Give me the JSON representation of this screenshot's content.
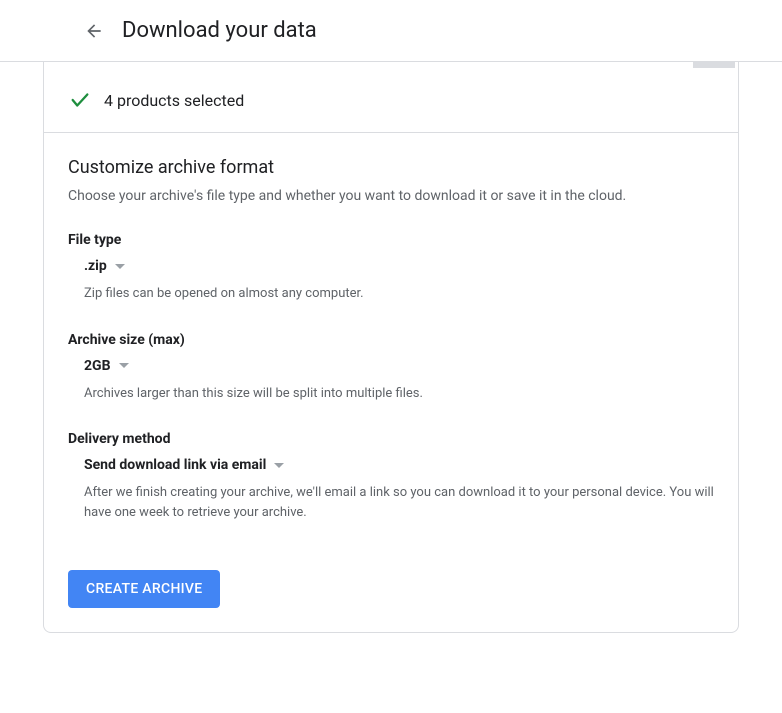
{
  "header": {
    "title": "Download your data"
  },
  "selected": {
    "text": "4 products selected"
  },
  "section": {
    "title": "Customize archive format",
    "description": "Choose your archive's file type and whether you want to download it or save it in the cloud."
  },
  "file_type": {
    "label": "File type",
    "value": ".zip",
    "help": "Zip files can be opened on almost any computer."
  },
  "archive_size": {
    "label": "Archive size (max)",
    "value": "2GB",
    "help": "Archives larger than this size will be split into multiple files."
  },
  "delivery": {
    "label": "Delivery method",
    "value": "Send download link via email",
    "help": "After we finish creating your archive, we'll email a link so you can download it to your personal device. You will have one week to retrieve your archive."
  },
  "button": {
    "label": "CREATE ARCHIVE"
  }
}
